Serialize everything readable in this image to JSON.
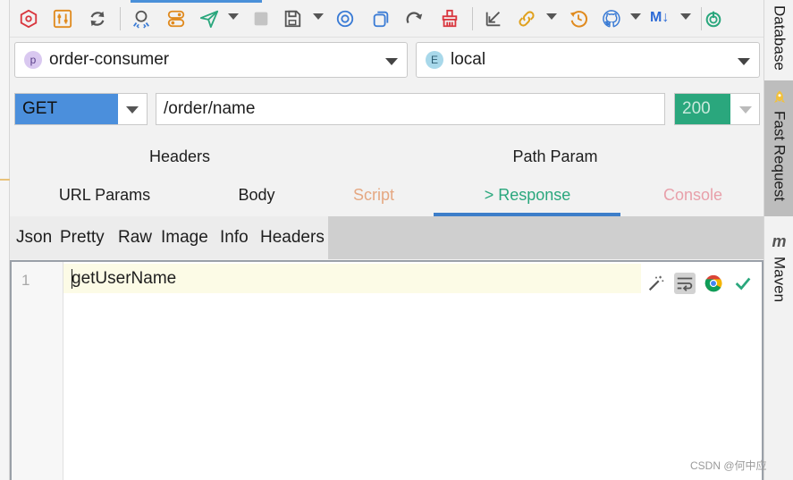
{
  "toolbar": {
    "icons": [
      "hexagon-icon",
      "sliders-icon",
      "refresh-icon",
      "api-search-icon",
      "toggle-icon",
      "send-icon",
      "stop-icon",
      "save-icon",
      "target-icon",
      "copy-icon",
      "redo-icon",
      "broom-icon",
      "import-icon",
      "link-icon",
      "history-icon",
      "github-icon",
      "markdown-icon",
      "power-icon"
    ],
    "markdown_label": "M↓"
  },
  "project_select": {
    "badge": "p",
    "value": "order-consumer",
    "badge_color": "#d9c8f0"
  },
  "env_select": {
    "badge": "E",
    "value": "local",
    "badge_color": "#a8d8ea"
  },
  "request": {
    "method": "GET",
    "url": "/order/name",
    "status": "200",
    "method_color": "#4b8fdc",
    "status_color": "#2aa77d"
  },
  "tabs_row1": [
    "Headers",
    "Path Param"
  ],
  "tabs_row2": [
    "URL Params",
    "Body",
    "Script",
    "> Response",
    "Console"
  ],
  "active_tab": "> Response",
  "subtabs": [
    "Json",
    "Pretty",
    "Raw",
    "Image",
    "Info",
    "Headers"
  ],
  "editor": {
    "line_number": "1",
    "content": "getUserName"
  },
  "sidebar": {
    "items": [
      "Database",
      "Fast Request",
      "Maven"
    ],
    "maven_logo": "m"
  },
  "watermark": "CSDN @何中应"
}
